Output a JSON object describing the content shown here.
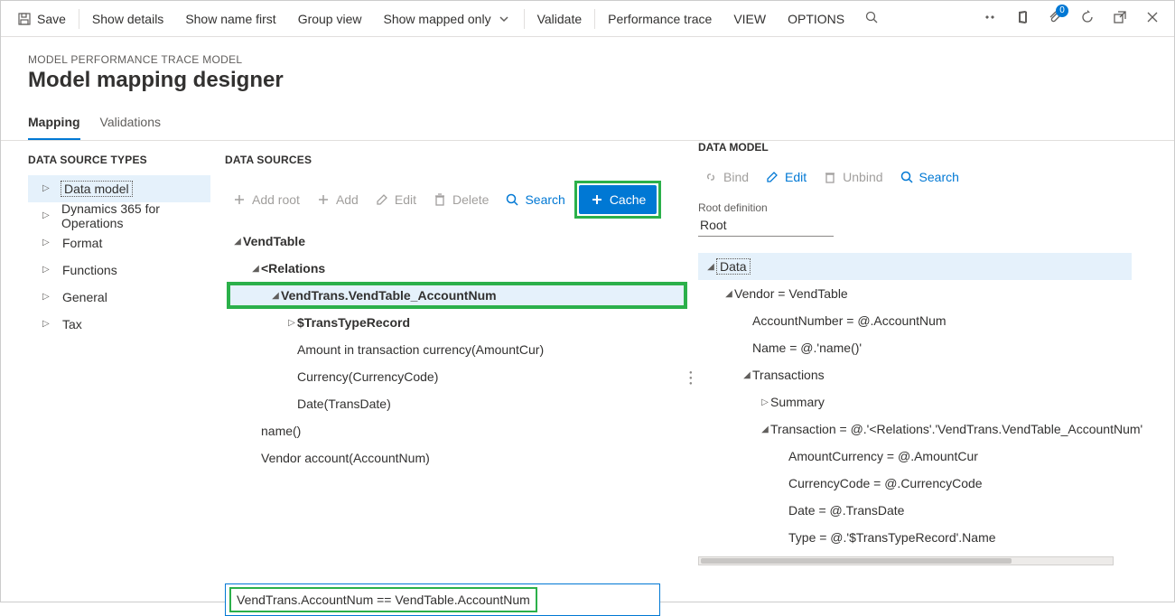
{
  "cmdbar": {
    "save": "Save",
    "show_details": "Show details",
    "show_name_first": "Show name first",
    "group_view": "Group view",
    "show_mapped_only": "Show mapped only",
    "validate": "Validate",
    "performance_trace": "Performance trace",
    "view": "VIEW",
    "options": "OPTIONS",
    "badge_count": "0"
  },
  "header": {
    "overline": "MODEL PERFORMANCE TRACE MODEL",
    "title": "Model mapping designer"
  },
  "tabs": {
    "mapping": "Mapping",
    "validations": "Validations"
  },
  "left": {
    "title": "DATA SOURCE TYPES",
    "items": [
      "Data model",
      "Dynamics 365 for Operations",
      "Format",
      "Functions",
      "General",
      "Tax"
    ]
  },
  "mid": {
    "title": "DATA SOURCES",
    "toolbar": {
      "add_root": "Add root",
      "add": "Add",
      "edit": "Edit",
      "delete": "Delete",
      "search": "Search",
      "cache": "Cache"
    },
    "tree": {
      "n0": "VendTable",
      "n1": "<Relations",
      "n2": "VendTrans.VendTable_AccountNum",
      "n3": "$TransTypeRecord",
      "n4": "Amount in transaction currency(AmountCur)",
      "n5": "Currency(CurrencyCode)",
      "n6": "Date(TransDate)",
      "n7": "name()",
      "n8": "Vendor account(AccountNum)"
    },
    "expression": "VendTrans.AccountNum == VendTable.AccountNum"
  },
  "right": {
    "title": "DATA MODEL",
    "toolbar": {
      "bind": "Bind",
      "edit": "Edit",
      "unbind": "Unbind",
      "search": "Search"
    },
    "root_label": "Root definition",
    "root_value": "Root",
    "tree": {
      "r0": "Data",
      "r1": "Vendor = VendTable",
      "r2": "AccountNumber = @.AccountNum",
      "r3": "Name = @.'name()'",
      "r4": "Transactions",
      "r5": "Summary",
      "r6": "Transaction = @.'<Relations'.'VendTrans.VendTable_AccountNum'",
      "r7": "AmountCurrency = @.AmountCur",
      "r8": "CurrencyCode = @.CurrencyCode",
      "r9": "Date = @.TransDate",
      "r10": "Type = @.'$TransTypeRecord'.Name"
    }
  }
}
